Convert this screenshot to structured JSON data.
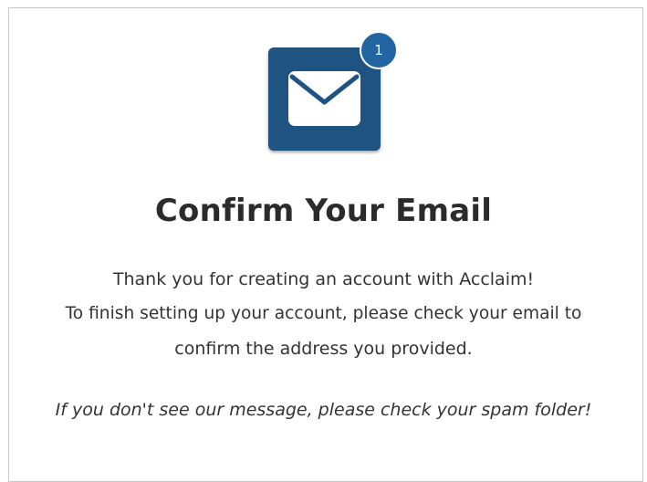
{
  "confirm": {
    "icon": "envelope-icon",
    "badge_count": "1",
    "title": "Confirm Your Email",
    "lines": [
      "Thank you for creating an account with Acclaim!",
      "To finish setting up your account, please check your email to",
      "confirm the address you provided."
    ],
    "note": "If you don't see our message, please check your spam folder!"
  },
  "colors": {
    "tile": "#1f5381",
    "badge": "#2166a3",
    "text": "#333333",
    "border": "#c9c9c9"
  }
}
